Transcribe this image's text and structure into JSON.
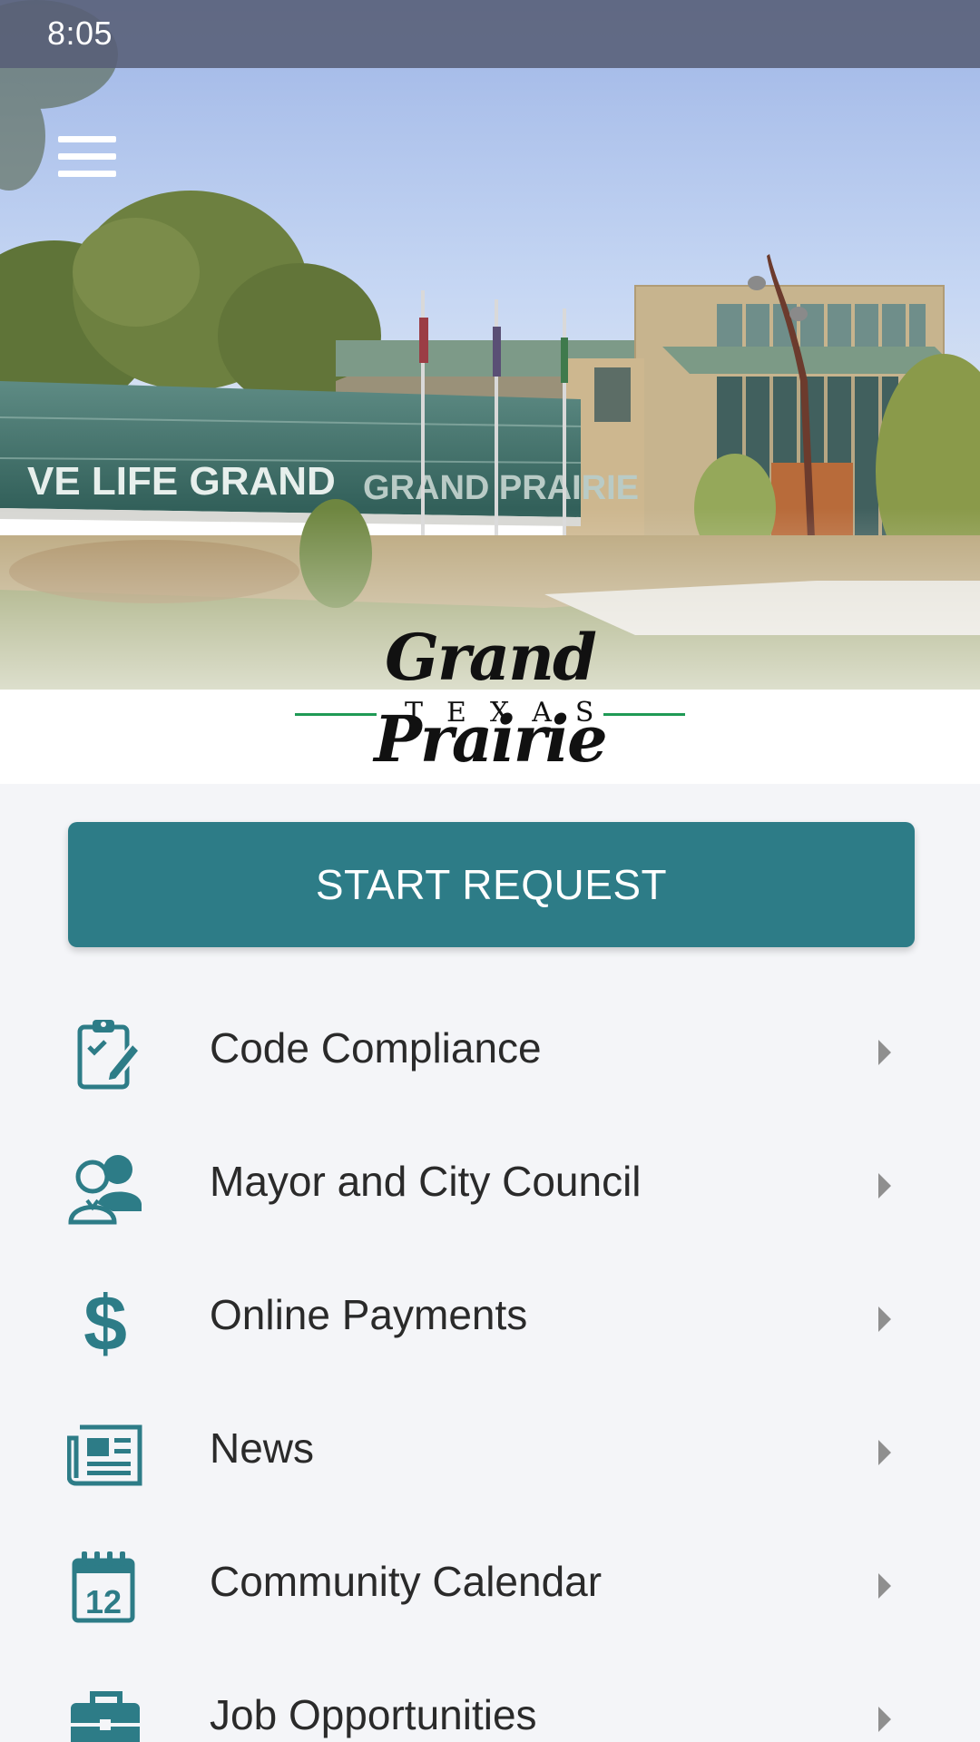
{
  "status_bar": {
    "time": "8:05"
  },
  "header": {
    "menu_icon": "hamburger-menu-icon",
    "building_sign_left": "VE LIFE GRAND",
    "building_sign_right": "GRAND PRAIRIE"
  },
  "logo": {
    "title": "Grand Prairie",
    "subtitle": "TEXAS"
  },
  "start_request": {
    "label": "START REQUEST"
  },
  "menu_items": [
    {
      "label": "Code Compliance",
      "icon": "clipboard-check-icon"
    },
    {
      "label": "Mayor and City Council",
      "icon": "people-icon"
    },
    {
      "label": "Online Payments",
      "icon": "dollar-icon"
    },
    {
      "label": "News",
      "icon": "newspaper-icon"
    },
    {
      "label": "Community Calendar",
      "icon": "calendar-icon"
    },
    {
      "label": "Job Opportunities",
      "icon": "briefcase-icon"
    }
  ],
  "colors": {
    "accent": "#2d7c87",
    "background": "#f4f5f8",
    "status_bar": "#5b6077",
    "logo_green": "#1f9a55"
  }
}
